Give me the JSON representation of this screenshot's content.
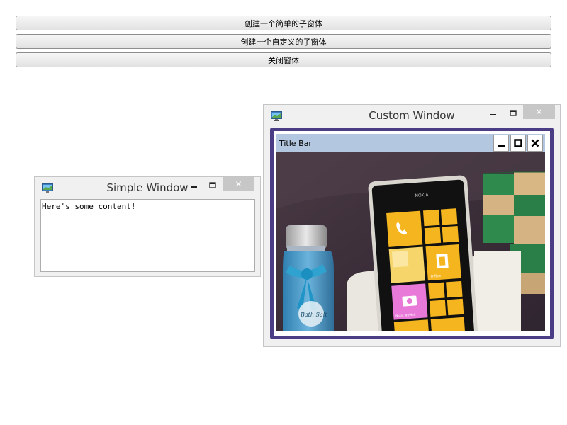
{
  "buttons": {
    "simple_label": "创建一个简单的子窗体",
    "custom_label": "创建一个自定义的子窗体",
    "close_label": "关闭窗体"
  },
  "simple_window": {
    "title": "Simple Window",
    "content": "Here's some content!",
    "close_glyph": "✕"
  },
  "custom_window": {
    "title": "Custom Window",
    "close_glyph": "✕",
    "inner_title": "Title Bar",
    "frame_color": "#4b3d85",
    "inner_title_color": "#b3c7e0"
  },
  "photo": {
    "jar_label": "Bath Salt",
    "phone_brand": "NOKIA",
    "tile_labels": [
      "Office",
      "Nokia 音乐电台"
    ]
  },
  "icons": [
    "app-icon",
    "minimize-icon",
    "maximize-icon",
    "close-icon"
  ]
}
